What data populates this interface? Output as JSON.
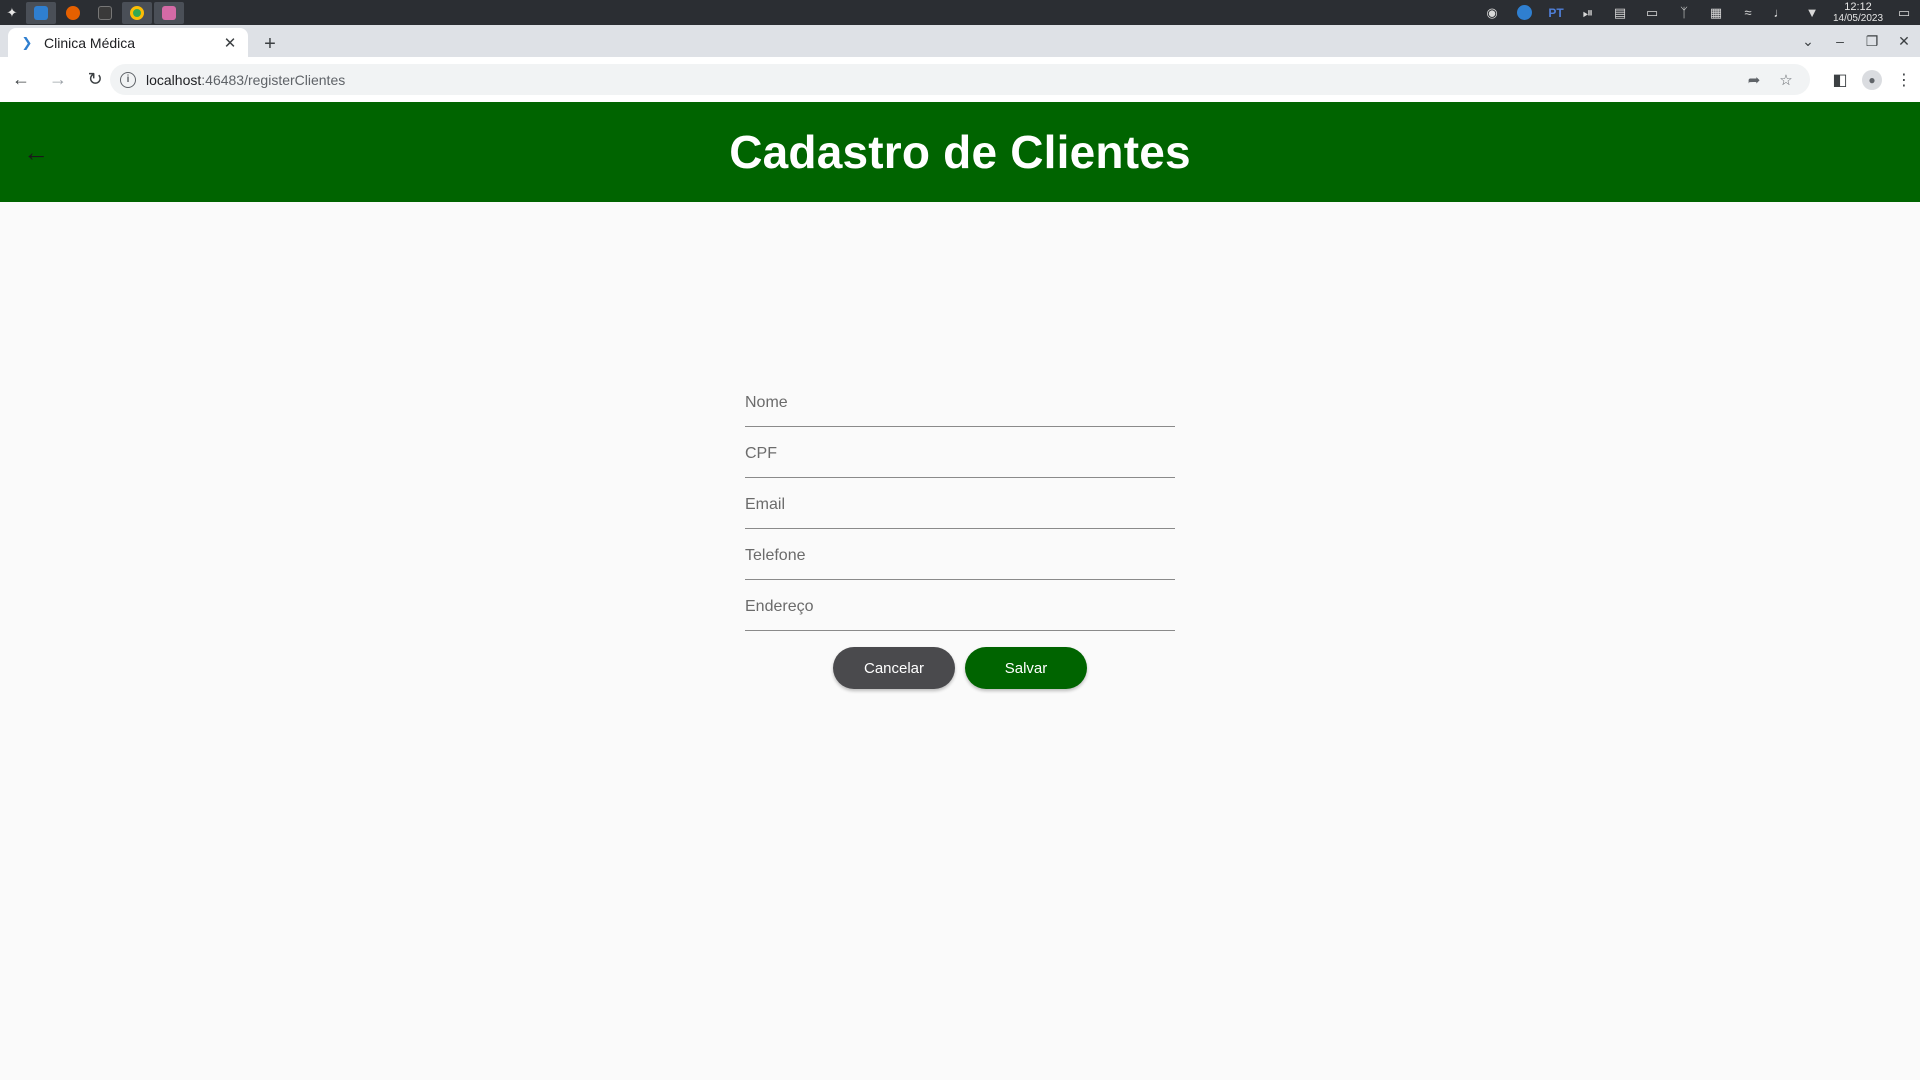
{
  "os": {
    "launcher_icon": "desktop-launcher-icon",
    "tasks": [
      {
        "name": "vscode-task",
        "color": "#2f7fd0",
        "active": true
      },
      {
        "name": "firefox-task",
        "color": "#e66000",
        "active": false
      },
      {
        "name": "terminal-task",
        "color": "#3a3a3a",
        "active": false
      },
      {
        "name": "chrome-task",
        "color": "#34a853",
        "active": true
      },
      {
        "name": "app-task",
        "color": "#d46aa6",
        "active": true
      }
    ],
    "tray": {
      "keyboard_layout": "PT"
    },
    "clock": {
      "time": "12:12",
      "date": "14/05/2023"
    }
  },
  "browser": {
    "tab": {
      "title": "Clinica Médica",
      "favicon": "flutter-icon"
    },
    "address": {
      "host": "localhost",
      "rest": ":46483/registerClientes"
    }
  },
  "app": {
    "title": "Cadastro de Clientes",
    "accent": "#006400",
    "form": {
      "fields": [
        {
          "key": "nome",
          "placeholder": "Nome",
          "value": ""
        },
        {
          "key": "cpf",
          "placeholder": "CPF",
          "value": ""
        },
        {
          "key": "email",
          "placeholder": "Email",
          "value": ""
        },
        {
          "key": "telefone",
          "placeholder": "Telefone",
          "value": ""
        },
        {
          "key": "endereco",
          "placeholder": "Endereço",
          "value": ""
        }
      ]
    },
    "buttons": {
      "cancel_label": "Cancelar",
      "save_label": "Salvar"
    }
  }
}
